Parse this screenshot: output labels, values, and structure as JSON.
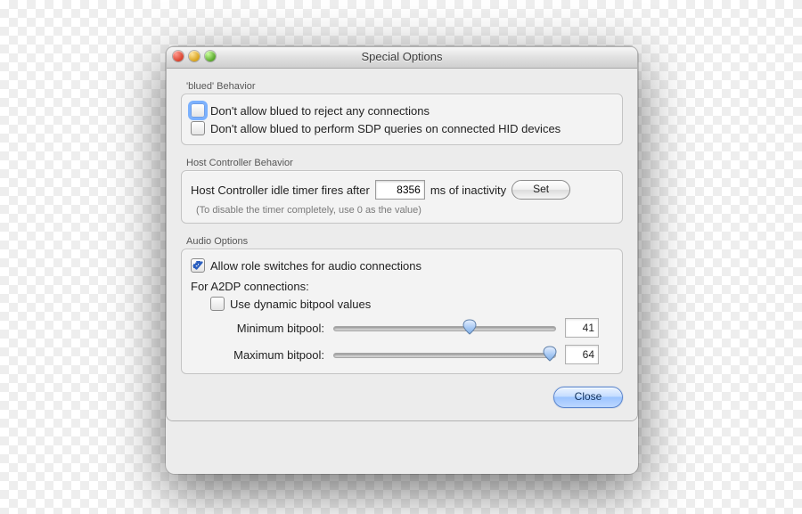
{
  "window": {
    "title": "Special Options"
  },
  "group_blued": {
    "legend": "'blued' Behavior",
    "opt_no_reject": "Don't allow blued to reject any connections",
    "opt_no_sdp": "Don't allow blued to perform SDP queries on connected HID devices"
  },
  "group_host": {
    "legend": "Host Controller Behavior",
    "label_pre": "Host Controller idle timer fires after",
    "value": "8356",
    "label_post": "ms of inactivity",
    "set_btn": "Set",
    "hint": "(To disable the timer completely, use 0 as the value)"
  },
  "group_audio": {
    "legend": "Audio Options",
    "allow_role_switch": "Allow role switches for audio connections",
    "a2dp_header": "For A2DP connections:",
    "dynamic_bitpool": "Use dynamic bitpool values",
    "min_label": "Minimum bitpool:",
    "min_value": "41",
    "min_pct": 61,
    "max_label": "Maximum bitpool:",
    "max_value": "64",
    "max_pct": 97
  },
  "footer": {
    "close": "Close"
  }
}
